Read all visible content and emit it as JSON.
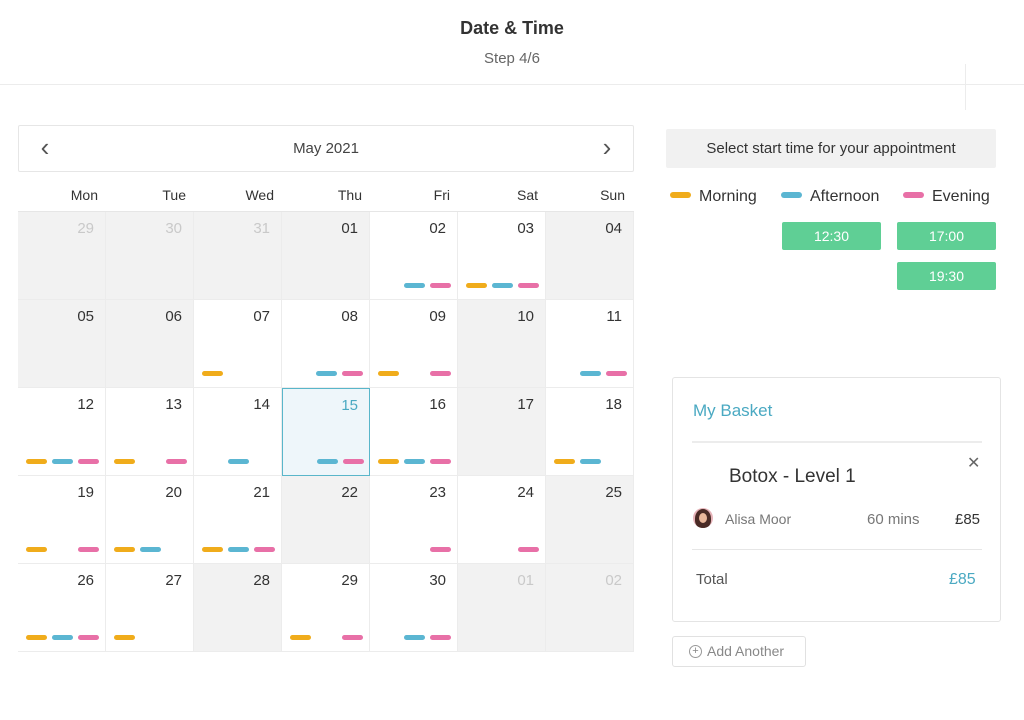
{
  "header": {
    "title": "Date & Time",
    "step": "Step 4/6"
  },
  "calendar": {
    "month": "May 2021",
    "prev_icon": "chevron-left-icon",
    "next_icon": "chevron-right-icon",
    "weekdays": [
      "Mon",
      "Tue",
      "Wed",
      "Thu",
      "Fri",
      "Sat",
      "Sun"
    ],
    "days": [
      {
        "label": "29",
        "state": "other",
        "slots": []
      },
      {
        "label": "30",
        "state": "other",
        "slots": []
      },
      {
        "label": "31",
        "state": "other",
        "slots": []
      },
      {
        "label": "01",
        "state": "disabled",
        "slots": []
      },
      {
        "label": "02",
        "state": "available",
        "slots": [
          "afternoon",
          "evening"
        ]
      },
      {
        "label": "03",
        "state": "available",
        "slots": [
          "morning",
          "afternoon",
          "evening"
        ]
      },
      {
        "label": "04",
        "state": "disabled",
        "slots": []
      },
      {
        "label": "05",
        "state": "disabled",
        "slots": []
      },
      {
        "label": "06",
        "state": "disabled",
        "slots": []
      },
      {
        "label": "07",
        "state": "available",
        "slots": [
          "morning"
        ]
      },
      {
        "label": "08",
        "state": "available",
        "slots": [
          "afternoon",
          "evening"
        ]
      },
      {
        "label": "09",
        "state": "available",
        "slots": [
          "morning",
          "evening"
        ]
      },
      {
        "label": "10",
        "state": "disabled",
        "slots": []
      },
      {
        "label": "11",
        "state": "available",
        "slots": [
          "afternoon",
          "evening"
        ]
      },
      {
        "label": "12",
        "state": "available",
        "slots": [
          "morning",
          "afternoon",
          "evening"
        ]
      },
      {
        "label": "13",
        "state": "available",
        "slots": [
          "morning",
          "evening"
        ]
      },
      {
        "label": "14",
        "state": "available",
        "slots": [
          "afternoon"
        ]
      },
      {
        "label": "15",
        "state": "today",
        "slots": [
          "afternoon",
          "evening"
        ]
      },
      {
        "label": "16",
        "state": "available",
        "slots": [
          "morning",
          "afternoon",
          "evening"
        ]
      },
      {
        "label": "17",
        "state": "disabled",
        "slots": []
      },
      {
        "label": "18",
        "state": "available",
        "slots": [
          "morning",
          "afternoon"
        ]
      },
      {
        "label": "19",
        "state": "available",
        "slots": [
          "morning",
          "evening"
        ]
      },
      {
        "label": "20",
        "state": "available",
        "slots": [
          "morning",
          "afternoon"
        ]
      },
      {
        "label": "21",
        "state": "available",
        "slots": [
          "morning",
          "afternoon",
          "evening"
        ]
      },
      {
        "label": "22",
        "state": "disabled",
        "slots": []
      },
      {
        "label": "23",
        "state": "available",
        "slots": [
          "evening"
        ]
      },
      {
        "label": "24",
        "state": "available",
        "slots": [
          "evening"
        ]
      },
      {
        "label": "25",
        "state": "disabled",
        "slots": []
      },
      {
        "label": "26",
        "state": "available",
        "slots": [
          "morning",
          "afternoon",
          "evening"
        ]
      },
      {
        "label": "27",
        "state": "available",
        "slots": [
          "morning"
        ]
      },
      {
        "label": "28",
        "state": "disabled",
        "slots": []
      },
      {
        "label": "29",
        "state": "available",
        "slots": [
          "morning",
          "evening"
        ]
      },
      {
        "label": "30",
        "state": "available",
        "slots": [
          "afternoon",
          "evening"
        ]
      },
      {
        "label": "01",
        "state": "other",
        "slots": []
      },
      {
        "label": "02",
        "state": "other",
        "slots": []
      }
    ]
  },
  "time_selector": {
    "prompt": "Select start time for your appointment",
    "legend": [
      {
        "label": "Morning",
        "color": "#f0ac1b"
      },
      {
        "label": "Afternoon",
        "color": "#5bb6d2"
      },
      {
        "label": "Evening",
        "color": "#e870a7"
      }
    ],
    "slots": [
      {
        "time": "12:30",
        "period": "afternoon"
      },
      {
        "time": "17:00",
        "period": "evening"
      },
      {
        "time": "19:30",
        "period": "evening"
      }
    ],
    "slot_color": "#5fcf95"
  },
  "basket": {
    "title": "My Basket",
    "service": "Botox - Level 1",
    "remove_icon": "close-icon",
    "staff": "Alisa Moor",
    "duration": "60 mins",
    "price": "£85",
    "total_label": "Total",
    "total_value": "£85"
  },
  "add_another": {
    "label": "Add Another",
    "icon": "plus-circle-icon"
  }
}
